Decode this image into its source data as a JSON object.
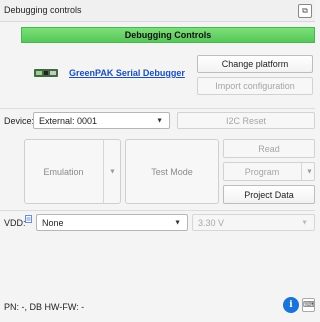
{
  "window": {
    "title": "Debugging controls",
    "float_icon": "⧉"
  },
  "header": {
    "title": "Debugging Controls"
  },
  "debugger": {
    "name": "GreenPAK Serial Debugger"
  },
  "buttons": {
    "change_platform": "Change platform",
    "import_configuration": "Import configuration",
    "i2c_reset": "I2C Reset",
    "emulation": "Emulation",
    "test_mode": "Test Mode",
    "read": "Read",
    "program": "Program",
    "project_data": "Project Data"
  },
  "device": {
    "label": "Device:",
    "value": "External: 0001"
  },
  "vdd": {
    "label": "VDD:",
    "value": "None",
    "voltage": "3.30 V"
  },
  "status": {
    "text": "PN: -, DB HW-FW: -"
  },
  "icons": {
    "info": "i",
    "chevron": "▼",
    "keyboard": "⌨"
  },
  "colors": {
    "header_green": "#5ccc5e",
    "link_blue": "#1b4fb8",
    "info_blue": "#1a73d9"
  }
}
